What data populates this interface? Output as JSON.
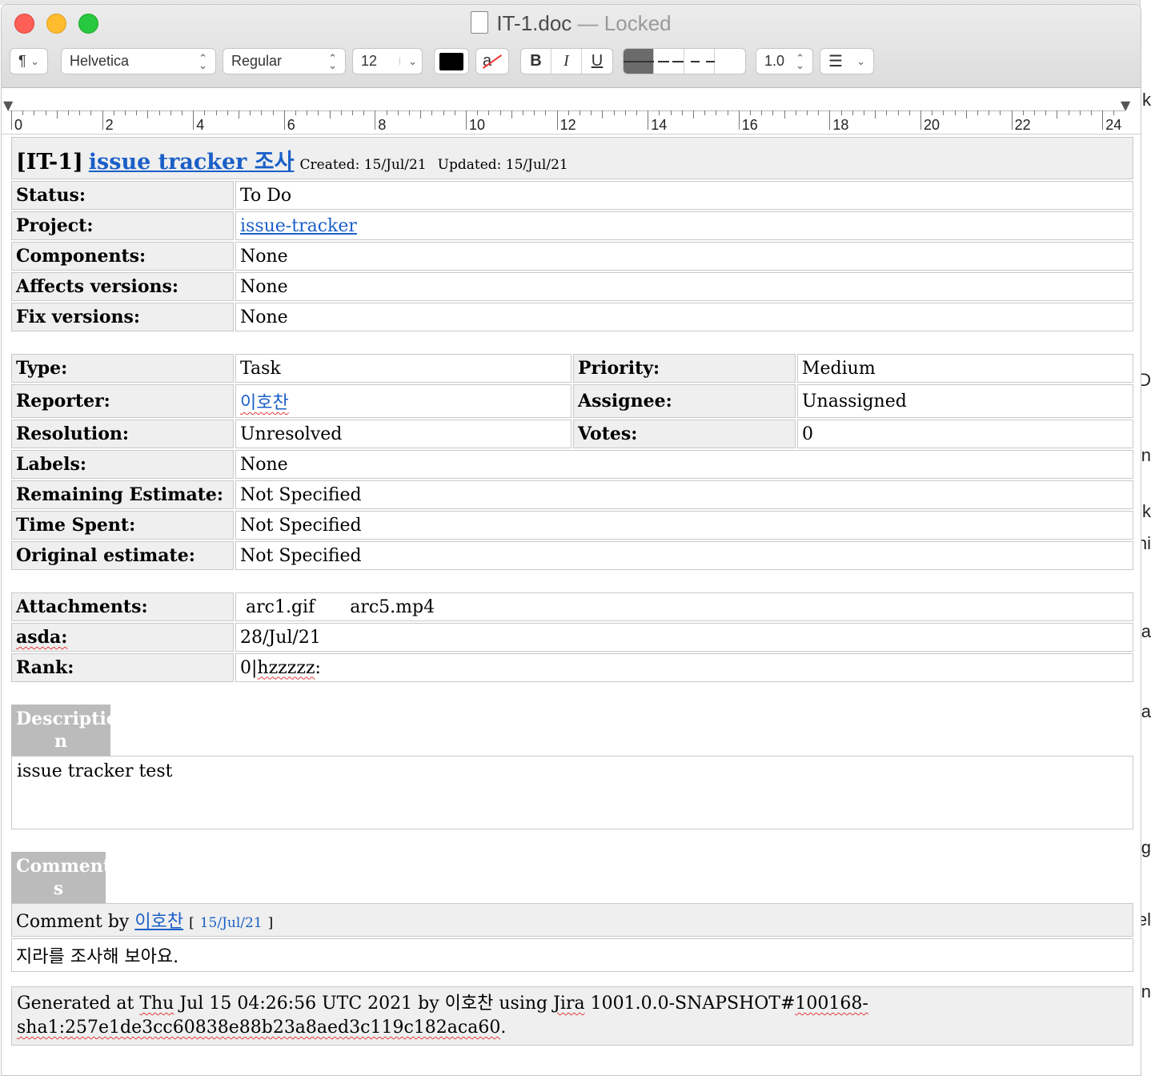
{
  "window": {
    "filename": "IT-1.doc",
    "separator": "—",
    "status": "Locked"
  },
  "toolbar": {
    "paragraph_style": "¶",
    "font_family": "Helvetica",
    "font_style": "Regular",
    "font_size": "12",
    "bold": "B",
    "italic": "I",
    "underline": "U",
    "line_spacing": "1.0",
    "text_color": "#000000",
    "highlight_label": "a"
  },
  "ruler": {
    "numbers": [
      "0",
      "2",
      "4",
      "6",
      "8",
      "10",
      "12",
      "14",
      "16",
      "18",
      "20",
      "22",
      "24"
    ]
  },
  "issue": {
    "key": "[IT-1]",
    "title": "issue tracker 조사",
    "created": "Created: 15/Jul/21",
    "updated": "Updated: 15/Jul/21"
  },
  "details": [
    {
      "label": "Status:",
      "value": "To Do"
    },
    {
      "label": "Project:",
      "value": "issue-tracker",
      "link": true
    },
    {
      "label": "Components:",
      "value": "None"
    },
    {
      "label": "Affects versions:",
      "value": "None"
    },
    {
      "label": "Fix versions:",
      "value": "None"
    }
  ],
  "people": {
    "type_label": "Type:",
    "type_value": "Task",
    "priority_label": "Priority:",
    "priority_value": "Medium",
    "reporter_label": "Reporter:",
    "reporter_value": "이호찬",
    "assignee_label": "Assignee:",
    "assignee_value": "Unassigned",
    "resolution_label": "Resolution:",
    "resolution_value": "Unresolved",
    "votes_label": "Votes:",
    "votes_value": "0",
    "labels_label": "Labels:",
    "labels_value": "None",
    "remaining_label": "Remaining Estimate:",
    "remaining_value": "Not Specified",
    "spent_label": "Time Spent:",
    "spent_value": "Not Specified",
    "original_label": "Original estimate:",
    "original_value": "Not Specified"
  },
  "extra": {
    "attachments_label": "Attachments:",
    "attachment_1": "arc1.gif",
    "attachment_2": "arc5.mp4",
    "asda_label": "asda:",
    "asda_value": "28/Jul/21",
    "rank_label": "Rank:",
    "rank_prefix": "0|",
    "rank_value": "hzzzzz",
    "rank_suffix": ":"
  },
  "description": {
    "title_line1": "Descriptio",
    "title_line2": "n",
    "body": "issue tracker test"
  },
  "comments": {
    "title_line1": "Comment",
    "title_line2": "s",
    "by_label": "Comment by",
    "author": "이호찬",
    "bracket_open": "[",
    "date": "15/Jul/21",
    "bracket_close": "]",
    "body": "지라를 조사해 보아요."
  },
  "footer": {
    "t1": "Generated at ",
    "t2": "Thu",
    "t3": " Jul 15 04:26:56 UTC 2021 by 이호찬 using ",
    "t4": "Jira",
    "t5": " 1001.0.0-SNAPSHOT#",
    "t6": "100168-",
    "t7": "sha1:257e1de3cc60838e88b23a8aed3c119c182aca60",
    "t8": "."
  }
}
